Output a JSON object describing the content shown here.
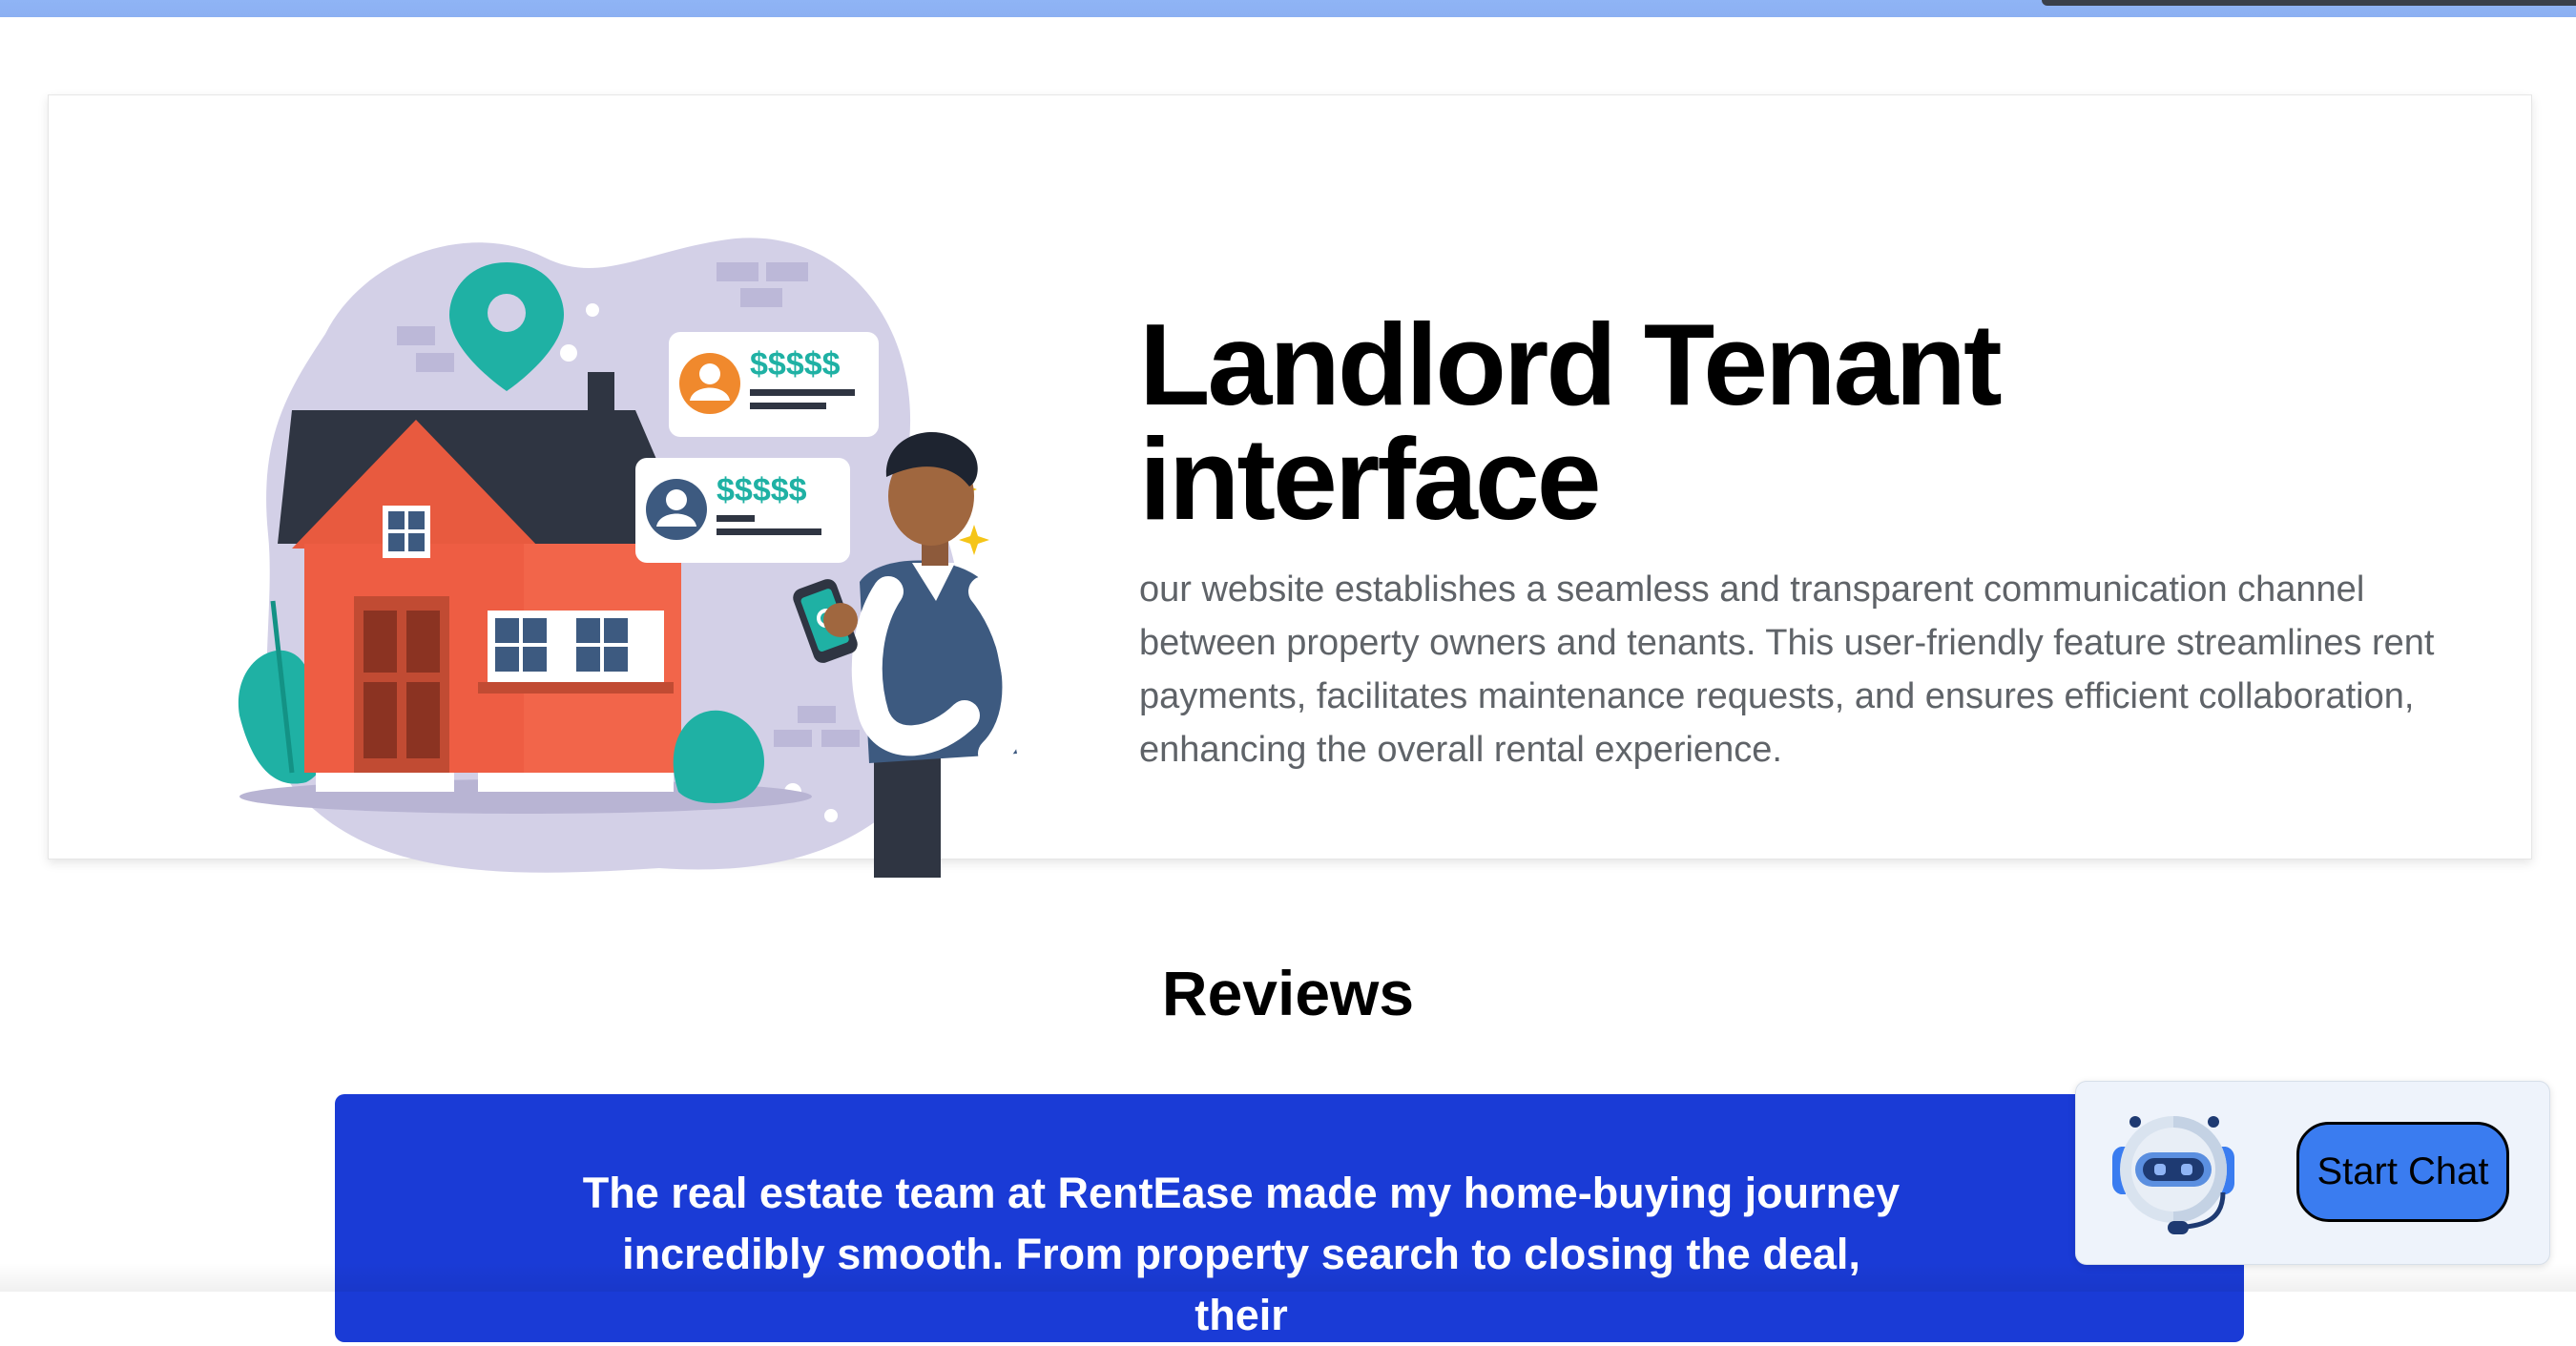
{
  "feature": {
    "title": "Landlord Tenant interface",
    "description": "our website establishes a seamless and transparent communication channel between property owners and tenants. This user-friendly feature streamlines rent payments, facilitates maintenance requests, and ensures efficient collaboration, enhancing the overall rental experience.",
    "illustration": {
      "icon": "landlord-tenant-illustration",
      "bubble_top_price": "$$$$$",
      "bubble_bottom_price": "$$$$$"
    }
  },
  "reviews": {
    "heading": "Reviews",
    "items": [
      {
        "text": "The real estate team at RentEase made my home-buying journey incredibly smooth. From property search to closing the deal, their"
      }
    ]
  },
  "chat": {
    "icon": "chatbot-robot-icon",
    "button_label": "Start Chat"
  },
  "colors": {
    "accent_blue": "#1a3bd6",
    "chat_button": "#3a7cf0",
    "top_bar": "#8fb4f5"
  }
}
